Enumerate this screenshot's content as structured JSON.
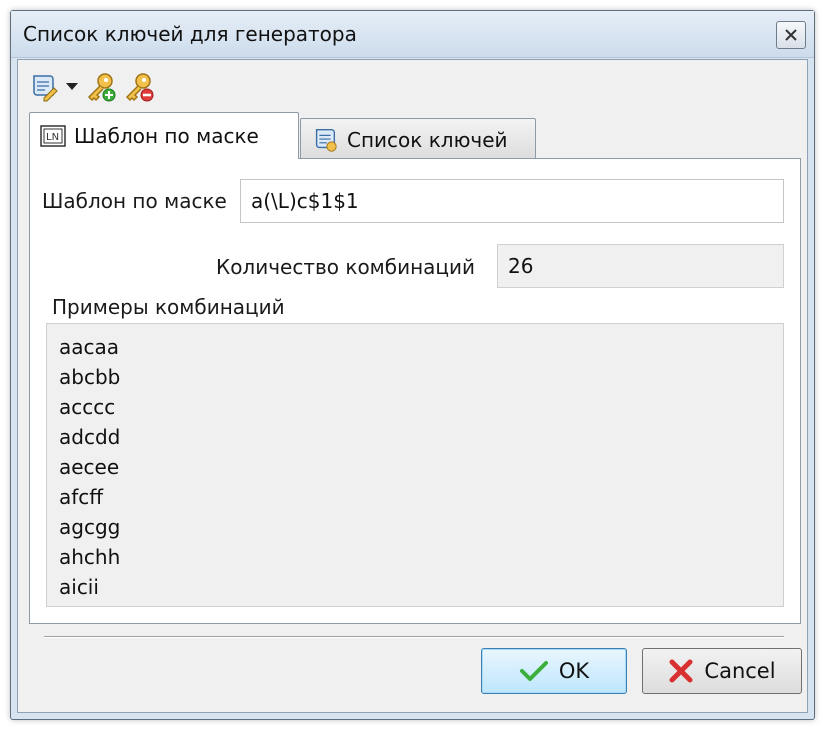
{
  "window": {
    "title": "Список ключей для генератора"
  },
  "toolbar": {
    "icons": [
      "script-edit-icon",
      "dropdown-arrow-icon",
      "key-add-icon",
      "key-remove-icon"
    ]
  },
  "tabs": [
    {
      "label": "Шаблон по маске",
      "icon": "mask-template-icon",
      "active": true
    },
    {
      "label": "Список ключей",
      "icon": "key-list-icon",
      "active": false
    }
  ],
  "form": {
    "mask_label": "Шаблон по маске",
    "mask_value": "a(\\L)c$1$1",
    "count_label": "Количество комбинаций",
    "count_value": "26",
    "examples_label": "Примеры комбинаций",
    "examples": [
      "aacaa",
      "abcbb",
      "acccc",
      "adcdd",
      "aecee",
      "afcff",
      "agcgg",
      "ahchh",
      "aicii"
    ]
  },
  "buttons": {
    "ok_label": "OK",
    "cancel_label": "Cancel"
  },
  "colors": {
    "ok_check": "#3cae3c",
    "cancel_x": "#d83030",
    "key": "#e3a52a"
  }
}
